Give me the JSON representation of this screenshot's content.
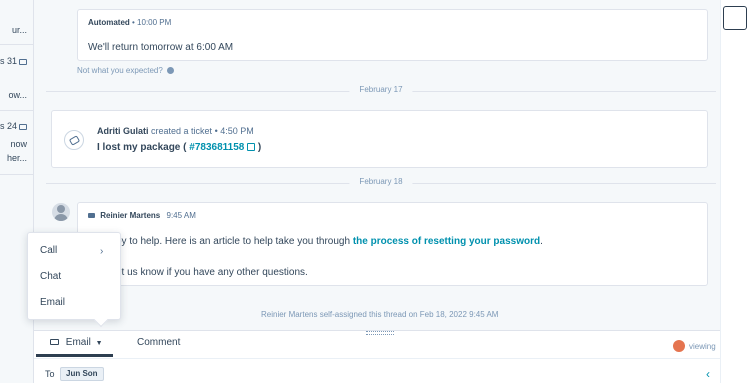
{
  "left_panel": {
    "items": [
      {
        "text": "ur..."
      },
      {
        "text": "s 31"
      },
      {
        "text": "ow..."
      },
      {
        "text": "s 24"
      },
      {
        "text": "now"
      },
      {
        "text": "her..."
      }
    ]
  },
  "thread": {
    "automated": {
      "author": "Automated",
      "time": "• 10:00 PM",
      "body": "We'll return tomorrow at 6:00 AM",
      "unexpected": "Not what you expected?"
    },
    "date1": "February 17",
    "ticket": {
      "author": "Adriti Gulati",
      "action": "created a ticket",
      "time": "• 4:50 PM",
      "title_prefix": "I lost my package (",
      "ticket_id": "#783681158",
      "title_suffix": ")"
    },
    "date2": "February 18",
    "reply": {
      "author": "Reinier Martens",
      "time": "9:45 AM",
      "line1_prefix": "py to help. Here is an article to help take you through",
      "line1_link": "the process of resetting your password",
      "line1_end": ".",
      "line2": "et us know if you have any other questions."
    },
    "assigned_note": "Reinier Martens self-assigned this thread on Feb 18, 2022 9:45 AM"
  },
  "menu": {
    "items": [
      {
        "label": "Call"
      },
      {
        "label": "Chat"
      },
      {
        "label": "Email"
      }
    ]
  },
  "composer": {
    "tab_email": "Email",
    "tab_comment": "Comment",
    "viewing": "viewing",
    "to_label": "To",
    "recipient": "Jun Son"
  },
  "colors": {
    "accent_link": "#0091ae",
    "text_dark": "#33475b",
    "background": "#f5f8fa",
    "viewing_dot": "#e5744f"
  }
}
